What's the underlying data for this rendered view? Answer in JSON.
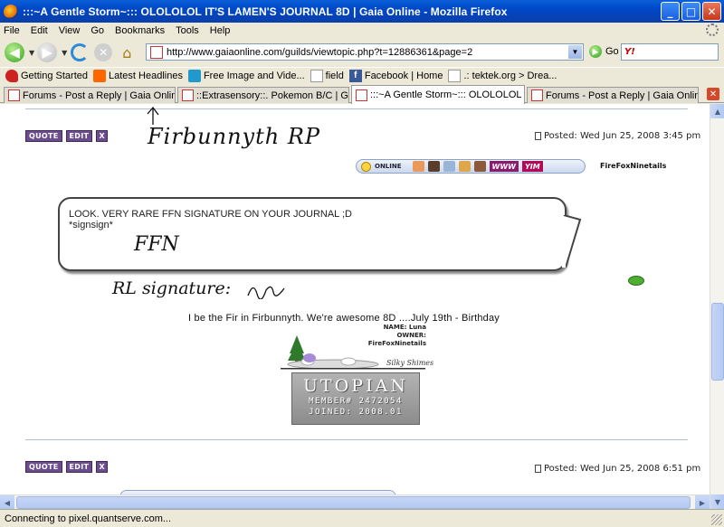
{
  "window": {
    "title": ":::~A Gentle Storm~::: OLOLOLOL IT'S LAMEN'S JOURNAL 8D | Gaia Online - Mozilla Firefox",
    "min": "_",
    "max": "□",
    "close": "✕"
  },
  "menu": [
    "File",
    "Edit",
    "View",
    "Go",
    "Bookmarks",
    "Tools",
    "Help"
  ],
  "nav": {
    "url": "http://www.gaiaonline.com/guilds/viewtopic.php?t=12886361&page=2",
    "go_label": "Go",
    "search_engine": "Y!"
  },
  "bookmarks": [
    {
      "label": "Getting Started",
      "icon": "red"
    },
    {
      "label": "Latest Headlines",
      "icon": "rss"
    },
    {
      "label": "Free Image and Vide...",
      "icon": "blue"
    },
    {
      "label": "field",
      "icon": "page"
    },
    {
      "label": "Facebook | Home",
      "icon": "fb"
    },
    {
      "label": ".: tektek.org > Drea...",
      "icon": "page"
    }
  ],
  "tabs": [
    {
      "label": "Forums - Post a Reply | Gaia Online",
      "active": false
    },
    {
      "label": "::Extrasensory::. Pokemon B/C | Gaia O...",
      "active": false
    },
    {
      "label": ":::~A Gentle Storm~::: OLOLOLOL IT...",
      "active": true
    },
    {
      "label": "Forums - Post a Reply | Gaia Online",
      "active": false
    }
  ],
  "post1": {
    "buttons": {
      "quote": "QUOTE",
      "edit": "EDIT",
      "delete": "X"
    },
    "posted": "Posted: Wed Jun 25, 2008 3:45 pm",
    "username": "FireFoxNinetails",
    "online": "ONLINE",
    "www": "WWW",
    "yim": "YIM",
    "annotation_top": "Firbunnyth RP",
    "bubble_line1": "LOOK. VERY RARE FFN SIGNATURE ON YOUR JOURNAL ;D",
    "bubble_line2": "*signsign*",
    "ffn_signature": "FFN",
    "annotation_rl": "RL signature:",
    "sig_text": "I be the Fir in Firbunnyth. We're awesome 8D ....July 19th - Birthday",
    "pet_name": "NAME: Luna",
    "pet_owner": "OWNER: FireFoxNinetails",
    "utopian_word": "UTOPIAN",
    "utopian_member": "MEMBER# 2472054",
    "utopian_joined": "JOINED: 2008.01"
  },
  "post2": {
    "buttons": {
      "quote": "QUOTE",
      "edit": "EDIT",
      "delete": "X"
    },
    "posted": "Posted: Wed Jun 25, 2008 6:51 pm"
  },
  "status": "Connecting to pixel.quantserve.com..."
}
